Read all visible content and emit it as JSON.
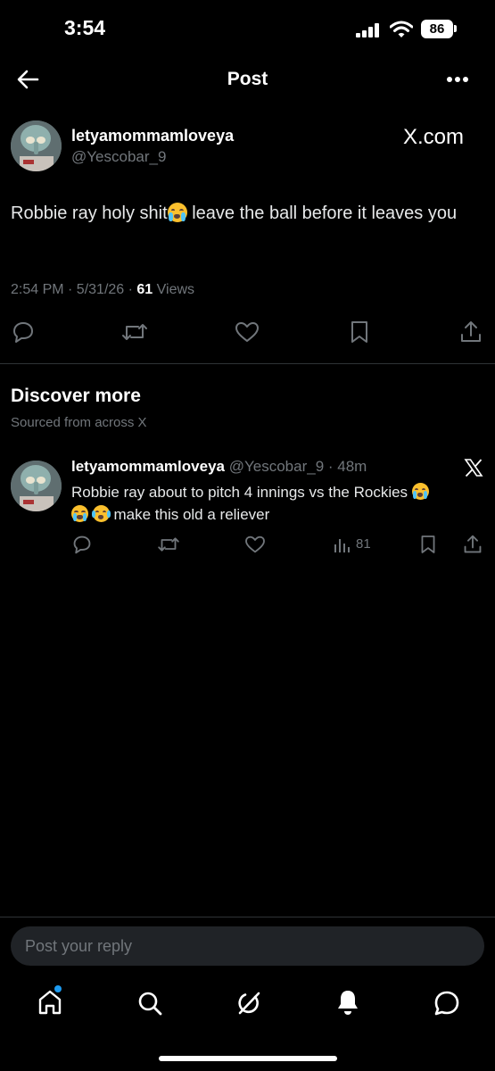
{
  "status_bar": {
    "time": "3:54",
    "battery": "86"
  },
  "header": {
    "title": "Post"
  },
  "post": {
    "display_name": "letyamommamloveya",
    "handle": "@Yescobar_9",
    "source_label": "X.com",
    "text_part1": "Robbie ray holy shit",
    "text_part2": " leave the ball before it leaves you",
    "timestamp": "2:54 PM · 5/31/26 · ",
    "views_count": "61",
    "views_label": " Views"
  },
  "discover": {
    "title": "Discover more",
    "subtitle": "Sourced from across X"
  },
  "related_post": {
    "display_name": "letyamommamloveya",
    "handle_time": "@Yescobar_9 · 48m",
    "text_part1": "Robbie ray about to pitch 4 innings vs the Rockies ",
    "text_part2": "make this old a reliever",
    "views": "81"
  },
  "reply": {
    "placeholder": "Post your reply"
  },
  "colors": {
    "background": "#000000",
    "muted": "#71767b",
    "accent": "#1d9bf0",
    "divider": "#2f3336"
  },
  "icons": {
    "nav": [
      "back-arrow-icon",
      "more-icon"
    ],
    "actions": [
      "reply-icon",
      "repost-icon",
      "like-icon",
      "bookmark-icon",
      "share-icon",
      "views-icon"
    ],
    "tabbar": [
      "home-icon",
      "search-icon",
      "grok-icon",
      "notifications-icon",
      "messages-icon"
    ]
  }
}
